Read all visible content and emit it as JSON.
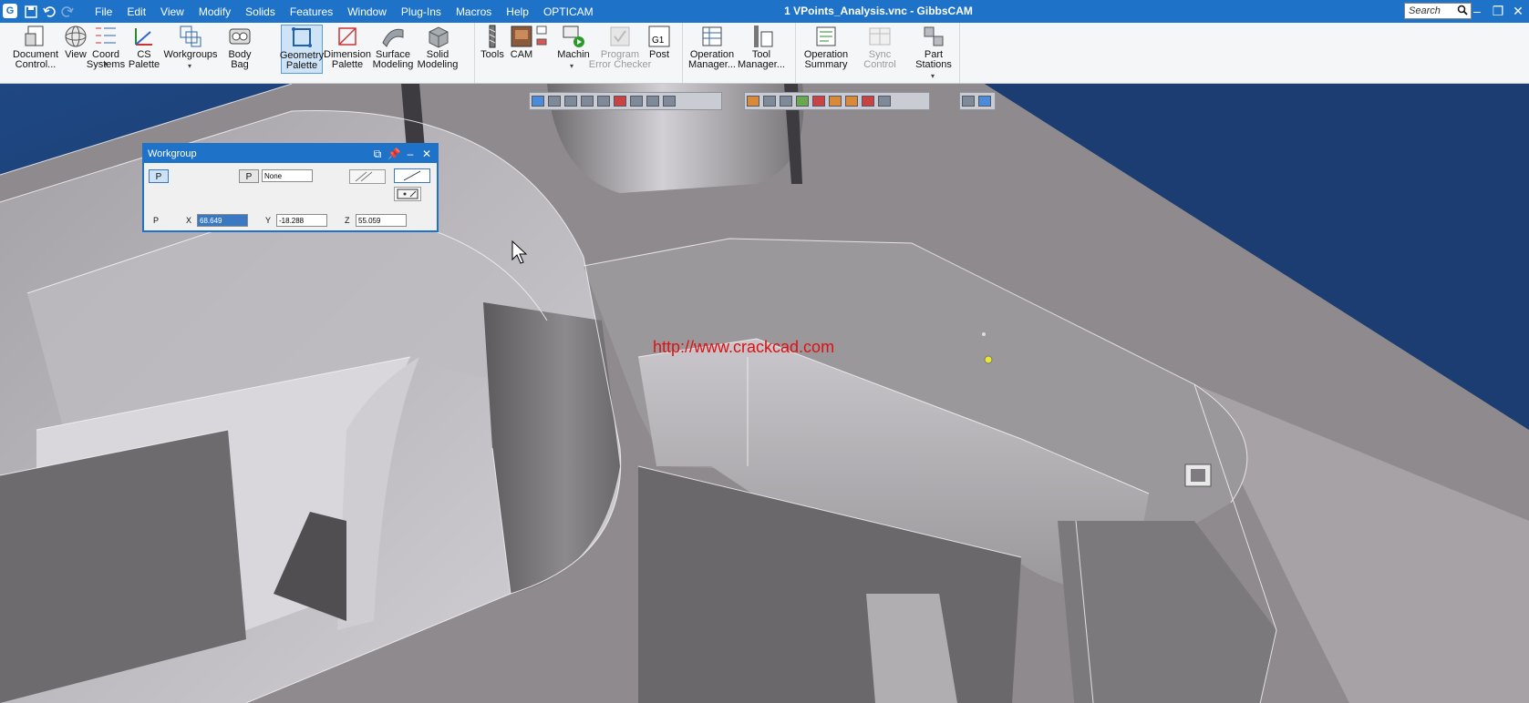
{
  "titlebar": {
    "app_icon": "gibbscam-logo-icon",
    "quick_access": [
      "save-icon",
      "undo-icon",
      "redo-icon"
    ],
    "menu": [
      "File",
      "Edit",
      "View",
      "Modify",
      "Solids",
      "Features",
      "Window",
      "Plug-Ins",
      "Macros",
      "Help",
      "OPTICAM"
    ],
    "document_title": "1 VPoints_Analysis.vnc - GibbsCAM",
    "search_placeholder": "Search",
    "window_controls": [
      "minimize-icon",
      "restore-icon",
      "close-icon"
    ]
  },
  "ribbon": {
    "buttons": [
      {
        "id": "document-control",
        "label1": "Document",
        "label2": "Control..."
      },
      {
        "id": "view",
        "label1": "View",
        "label2": ""
      },
      {
        "id": "coord-systems",
        "label1": "Coord",
        "label2": "Systems"
      },
      {
        "id": "cs-palette",
        "label1": "CS Palette",
        "label2": ""
      },
      {
        "id": "workgroups",
        "label1": "Workgroups",
        "label2": ""
      },
      {
        "id": "body-bag",
        "label1": "Body Bag",
        "label2": ""
      },
      {
        "id": "geometry-palette",
        "label1": "Geometry",
        "label2": "Palette"
      },
      {
        "id": "dimension-palette",
        "label1": "Dimension",
        "label2": "Palette"
      },
      {
        "id": "surface-modeling",
        "label1": "Surface",
        "label2": "Modeling"
      },
      {
        "id": "solid-modeling",
        "label1": "Solid",
        "label2": "Modeling"
      },
      {
        "id": "tools",
        "label1": "Tools",
        "label2": ""
      },
      {
        "id": "cam",
        "label1": "CAM",
        "label2": ""
      },
      {
        "id": "machin",
        "label1": "Machin",
        "label2": ""
      },
      {
        "id": "program-error-checker",
        "label1": "Program",
        "label2": "Error Checker"
      },
      {
        "id": "post",
        "label1": "Post",
        "label2": ""
      },
      {
        "id": "operation-manager",
        "label1": "Operation",
        "label2": "Manager..."
      },
      {
        "id": "tool-manager",
        "label1": "Tool",
        "label2": "Manager..."
      },
      {
        "id": "operation-summary",
        "label1": "Operation",
        "label2": "Summary"
      },
      {
        "id": "sync-control",
        "label1": "Sync Control",
        "label2": ""
      },
      {
        "id": "part-stations",
        "label1": "Part Stations",
        "label2": ""
      }
    ],
    "post_badge": "G1",
    "selected": "geometry-palette",
    "disabled": [
      "program-error-checker",
      "sync-control"
    ]
  },
  "workgroup_dialog": {
    "title": "Workgroup",
    "p_button": "P",
    "p_button2": "P",
    "workgroup_value": "None",
    "point_label": "P",
    "x_label": "X",
    "x_value": "68.649",
    "y_label": "Y",
    "y_value": "-18.288",
    "z_label": "Z",
    "z_value": "55.059"
  },
  "watermark": "http://www.crackcad.com",
  "colors": {
    "titlebar": "#1e73c8",
    "ribbon": "#f5f6f7",
    "viewport_bg": "#163566",
    "part_surface": "#8e8a8e",
    "watermark": "#e01010",
    "selection_point": "#e8e830"
  }
}
